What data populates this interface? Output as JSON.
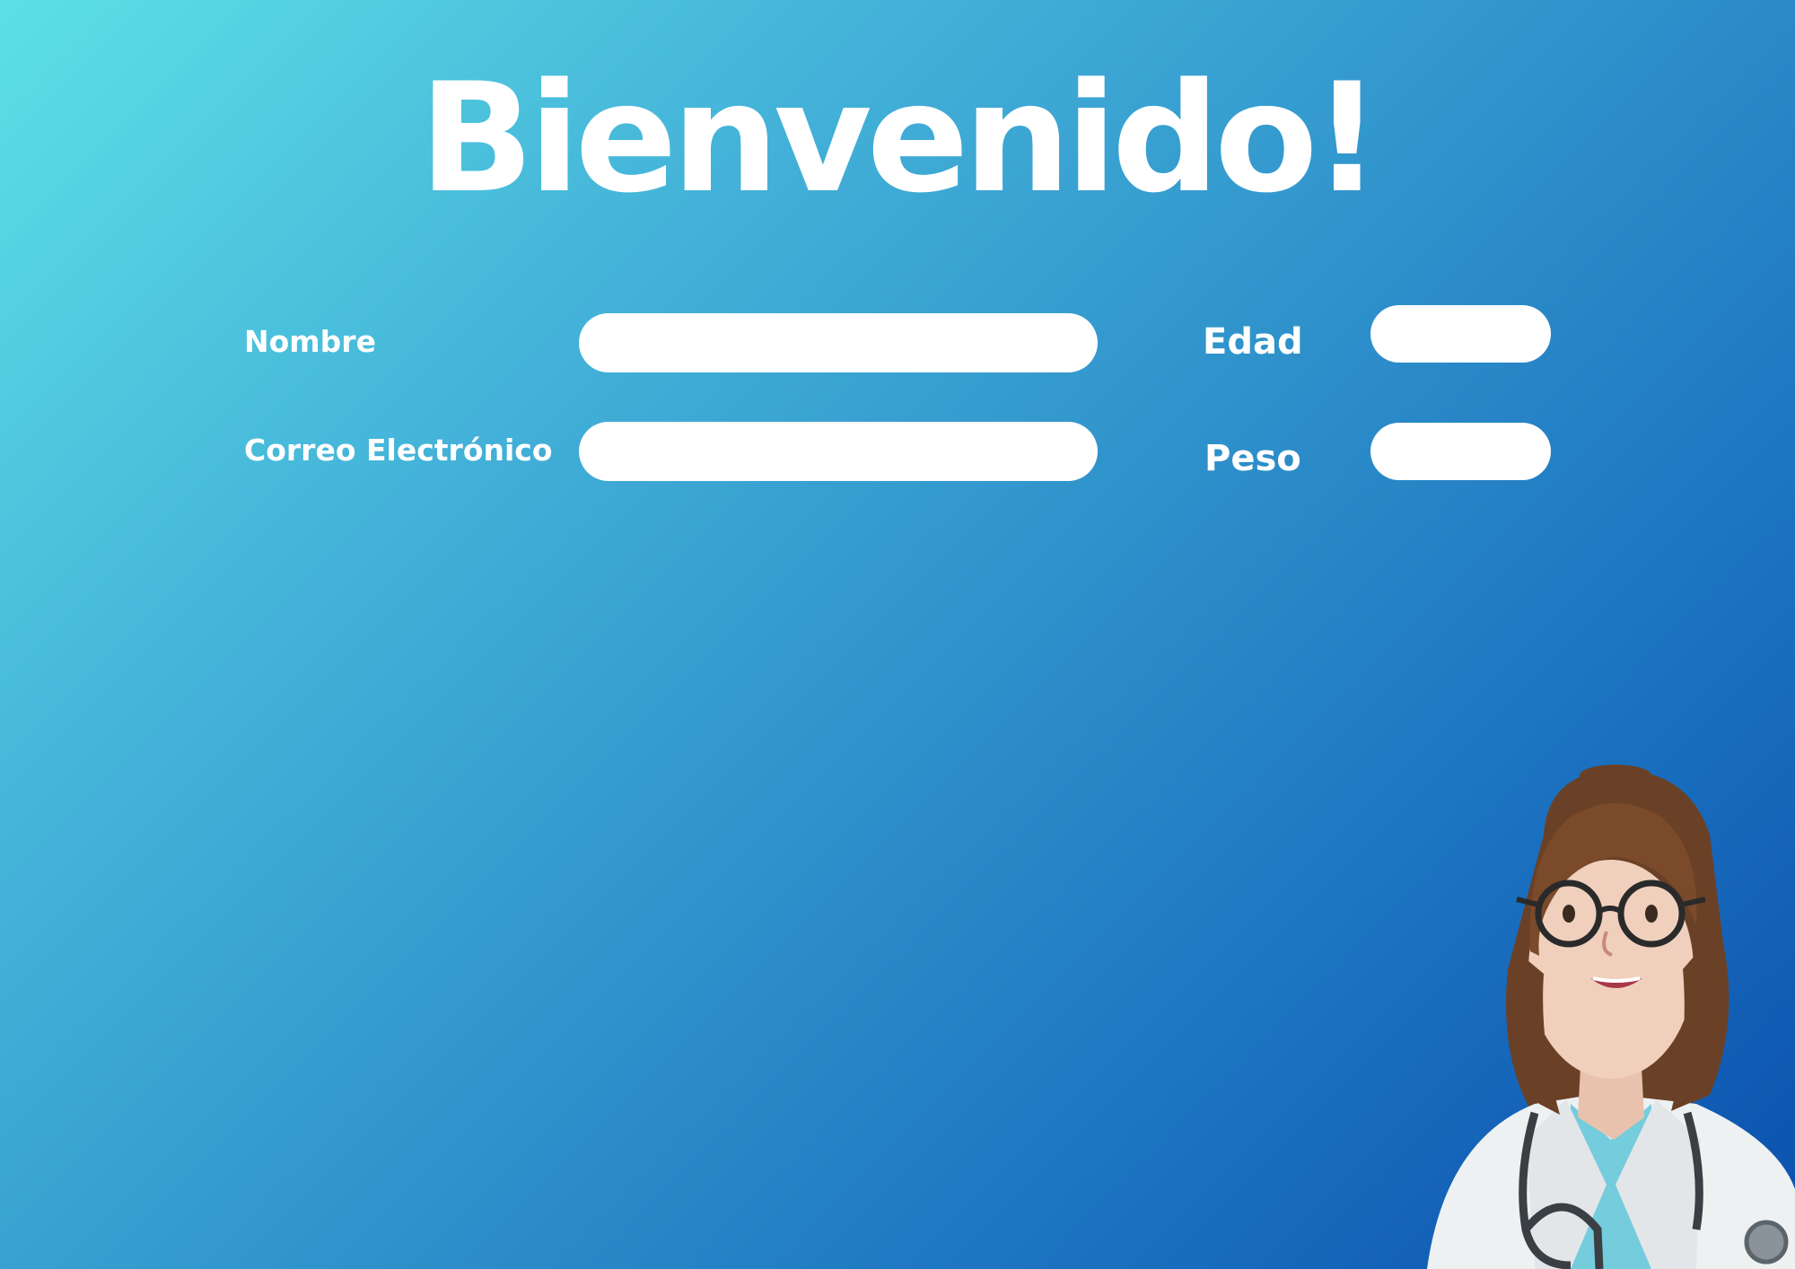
{
  "header": {
    "title": "Bienvenido!"
  },
  "form": {
    "name_label": "Nombre",
    "name_value": "",
    "email_label": "Correo Electrónico",
    "email_value": "",
    "age_label": "Edad",
    "age_value": "",
    "weight_label": "Peso",
    "weight_value": ""
  },
  "illustration": {
    "icon": "doctor-avatar"
  },
  "colors": {
    "gradient_start": "#5ce0e6",
    "gradient_end": "#0b50ad",
    "text": "#ffffff",
    "field": "#ffffff"
  }
}
